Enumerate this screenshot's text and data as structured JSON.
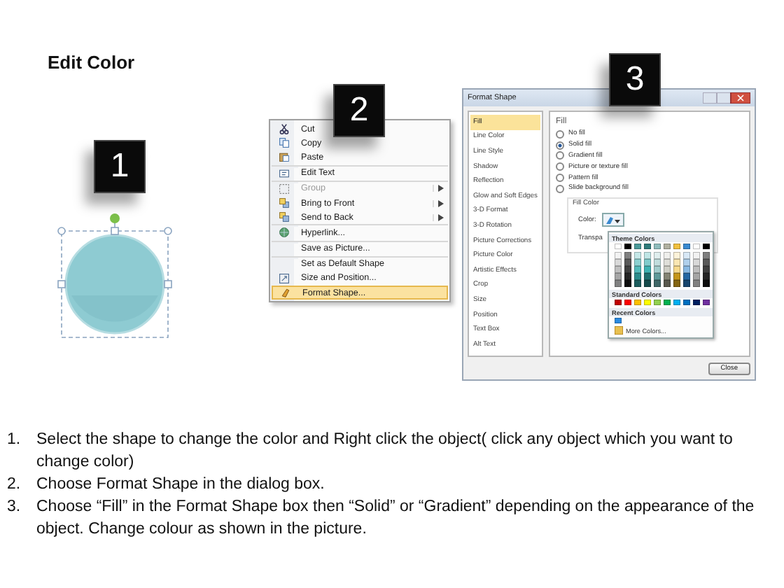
{
  "slide": {
    "title": "Edit Color"
  },
  "badges": [
    {
      "label": "1"
    },
    {
      "label": "2"
    },
    {
      "label": "3"
    }
  ],
  "context_menu": {
    "items": [
      {
        "label": "Cut",
        "disabled": false,
        "submenu": false,
        "divider_above": false,
        "selected": false
      },
      {
        "label": "Copy",
        "disabled": false,
        "submenu": false,
        "divider_above": false,
        "selected": false
      },
      {
        "label": "Paste",
        "disabled": false,
        "submenu": false,
        "divider_above": false,
        "selected": false
      },
      {
        "label": "Edit Text",
        "disabled": false,
        "submenu": false,
        "divider_above": true,
        "selected": false
      },
      {
        "label": "Group",
        "disabled": true,
        "submenu": true,
        "divider_above": true,
        "selected": false
      },
      {
        "label": "Bring to Front",
        "disabled": false,
        "submenu": true,
        "divider_above": false,
        "selected": false
      },
      {
        "label": "Send to Back",
        "disabled": false,
        "submenu": true,
        "divider_above": false,
        "selected": false
      },
      {
        "label": "Hyperlink...",
        "disabled": false,
        "submenu": false,
        "divider_above": true,
        "selected": false
      },
      {
        "label": "Save as Picture...",
        "disabled": false,
        "submenu": false,
        "divider_above": true,
        "selected": false
      },
      {
        "label": "Set as Default Shape",
        "disabled": false,
        "submenu": false,
        "divider_above": true,
        "selected": false
      },
      {
        "label": "Size and Position...",
        "disabled": false,
        "submenu": false,
        "divider_above": false,
        "selected": false
      },
      {
        "label": "Format Shape...",
        "disabled": false,
        "submenu": false,
        "divider_above": false,
        "selected": true
      }
    ]
  },
  "dialog": {
    "title": "Format Shape",
    "nav": [
      {
        "label": "Fill",
        "selected": true
      },
      {
        "label": "Line Color",
        "selected": false
      },
      {
        "label": "Line Style",
        "selected": false
      },
      {
        "label": "Shadow",
        "selected": false
      },
      {
        "label": "Reflection",
        "selected": false
      },
      {
        "label": "Glow and Soft Edges",
        "selected": false
      },
      {
        "label": "3-D Format",
        "selected": false
      },
      {
        "label": "3-D Rotation",
        "selected": false
      },
      {
        "label": "Picture Corrections",
        "selected": false
      },
      {
        "label": "Picture Color",
        "selected": false
      },
      {
        "label": "Artistic Effects",
        "selected": false
      },
      {
        "label": "Crop",
        "selected": false
      },
      {
        "label": "Size",
        "selected": false
      },
      {
        "label": "Position",
        "selected": false
      },
      {
        "label": "Text Box",
        "selected": false
      },
      {
        "label": "Alt Text",
        "selected": false
      }
    ],
    "pane_title": "Fill",
    "fill_options": [
      {
        "label": "No fill",
        "selected": false
      },
      {
        "label": "Solid fill",
        "selected": true
      },
      {
        "label": "Gradient fill",
        "selected": false
      },
      {
        "label": "Picture or texture fill",
        "selected": false
      },
      {
        "label": "Pattern fill",
        "selected": false
      },
      {
        "label": "Slide background fill",
        "selected": false
      }
    ],
    "fill_color": {
      "group_label": "Fill Color",
      "color_label": "Color:",
      "transparency_label": "Transpa"
    },
    "palette": {
      "theme_title": "Theme Colors",
      "theme_columns": [
        {
          "color": "#ffffff",
          "shades": [
            {
              "color": "#f2f2f2"
            },
            {
              "color": "#d9d9d9"
            },
            {
              "color": "#bfbfbf"
            },
            {
              "color": "#a6a6a6"
            },
            {
              "color": "#808080"
            }
          ]
        },
        {
          "color": "#000000",
          "shades": [
            {
              "color": "#7f7f7f"
            },
            {
              "color": "#595959"
            },
            {
              "color": "#3f3f3f"
            },
            {
              "color": "#262626"
            },
            {
              "color": "#0d0d0d"
            }
          ]
        },
        {
          "color": "#4a9a9a",
          "shades": [
            {
              "color": "#c5e8e8"
            },
            {
              "color": "#8cd2d2"
            },
            {
              "color": "#53bbbb"
            },
            {
              "color": "#2a8c8c"
            },
            {
              "color": "#1c5d5d"
            }
          ]
        },
        {
          "color": "#2e7b7b",
          "shades": [
            {
              "color": "#c0e6e6"
            },
            {
              "color": "#81cdcd"
            },
            {
              "color": "#3fb3b3"
            },
            {
              "color": "#1f6f6f"
            },
            {
              "color": "#154a4a"
            }
          ]
        },
        {
          "color": "#8fbcbc",
          "shades": [
            {
              "color": "#e0eeee"
            },
            {
              "color": "#c1dddd"
            },
            {
              "color": "#a3cccc"
            },
            {
              "color": "#5f9a9a"
            },
            {
              "color": "#3f6767"
            }
          ]
        },
        {
          "color": "#b0b0a0",
          "shades": [
            {
              "color": "#efefec"
            },
            {
              "color": "#dfdfd9"
            },
            {
              "color": "#cfcfc6"
            },
            {
              "color": "#848474"
            },
            {
              "color": "#58584d"
            }
          ]
        },
        {
          "color": "#f0c040",
          "shades": [
            {
              "color": "#fcf2d9"
            },
            {
              "color": "#f9e6b3"
            },
            {
              "color": "#f6d98c"
            },
            {
              "color": "#c5961a"
            },
            {
              "color": "#836411"
            }
          ]
        },
        {
          "color": "#3a8ad0",
          "shades": [
            {
              "color": "#d8e8f6"
            },
            {
              "color": "#b0d0ec"
            },
            {
              "color": "#89b9e3"
            },
            {
              "color": "#2467a3"
            },
            {
              "color": "#18456d"
            }
          ]
        },
        {
          "color": "#ffffff",
          "shades": [
            {
              "color": "#f2f2f2"
            },
            {
              "color": "#d9d9d9"
            },
            {
              "color": "#bfbfbf"
            },
            {
              "color": "#a6a6a6"
            },
            {
              "color": "#808080"
            }
          ]
        },
        {
          "color": "#000000",
          "shades": [
            {
              "color": "#7f7f7f"
            },
            {
              "color": "#595959"
            },
            {
              "color": "#3f3f3f"
            },
            {
              "color": "#262626"
            },
            {
              "color": "#0d0d0d"
            }
          ]
        }
      ],
      "standard_title": "Standard Colors",
      "standard": [
        {
          "color": "#c00000"
        },
        {
          "color": "#ff0000"
        },
        {
          "color": "#ffc000"
        },
        {
          "color": "#ffff00"
        },
        {
          "color": "#92d050"
        },
        {
          "color": "#00b050"
        },
        {
          "color": "#00b0f0"
        },
        {
          "color": "#0070c0"
        },
        {
          "color": "#002060"
        },
        {
          "color": "#7030a0"
        }
      ],
      "recent_title": "Recent Colors",
      "recent": [
        {
          "color": "#2a8ae0"
        }
      ],
      "more": "More Colors..."
    },
    "close_button": "Close"
  },
  "instructions": [
    {
      "number": "1.",
      "text": "Select the shape to change the color and Right click the object( click any object which you want to change color)"
    },
    {
      "number": "2.",
      "text": "Choose Format Shape in the dialog box."
    },
    {
      "number": "3.",
      "text": "Choose “Fill” in the Format Shape box then “Solid” or “Gradient” depending on the appearance of the object. Change colour as shown in the picture."
    }
  ]
}
